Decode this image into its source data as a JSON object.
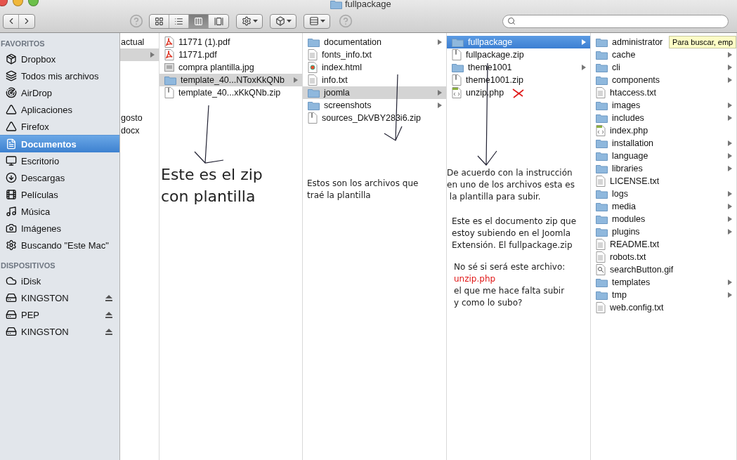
{
  "window": {
    "title": "fullpackage"
  },
  "toolbar": {
    "view_modes": [
      {
        "kind": "icons",
        "selected": false
      },
      {
        "kind": "list",
        "selected": false
      },
      {
        "kind": "columns",
        "selected": true
      },
      {
        "kind": "coverflow",
        "selected": false
      }
    ]
  },
  "sidebar": {
    "sections": [
      {
        "title": "FAVORITOS",
        "items": [
          {
            "label": "Dropbox",
            "kind": "box",
            "selected": false
          },
          {
            "label": "Todos mis archivos",
            "kind": "stack",
            "selected": false
          },
          {
            "label": "AirDrop",
            "kind": "airdrop",
            "selected": false
          },
          {
            "label": "Aplicaciones",
            "kind": "apps",
            "selected": false
          },
          {
            "label": "Firefox",
            "kind": "apps",
            "selected": false
          },
          {
            "label": "Documentos",
            "kind": "documents",
            "selected": true
          },
          {
            "label": "Escritorio",
            "kind": "desktop",
            "selected": false
          },
          {
            "label": "Descargas",
            "kind": "downloads",
            "selected": false
          },
          {
            "label": "Películas",
            "kind": "movies",
            "selected": false
          },
          {
            "label": "Música",
            "kind": "music",
            "selected": false
          },
          {
            "label": "Imágenes",
            "kind": "camera",
            "selected": false
          },
          {
            "label": "Buscando \"Este Mac\"",
            "kind": "gear",
            "selected": false
          }
        ]
      },
      {
        "title": "DISPOSITIVOS",
        "items": [
          {
            "label": "iDisk",
            "kind": "idisk",
            "selected": false,
            "eject": false
          },
          {
            "label": "KINGSTON",
            "kind": "drive",
            "selected": false,
            "eject": true
          },
          {
            "label": "PEP",
            "kind": "drive",
            "selected": false,
            "eject": true
          },
          {
            "label": "KINGSTON",
            "kind": "drive",
            "selected": false,
            "eject": true
          }
        ]
      }
    ]
  },
  "columns": [
    {
      "active": false,
      "items": [
        {
          "name": "actual",
          "kind": "partial",
          "selected": false
        },
        {
          "kind": "folder",
          "selected": true
        },
        {
          "kind": "blank",
          "selected": false
        },
        {
          "kind": "blank",
          "selected": false
        },
        {
          "kind": "blank",
          "selected": false
        },
        {
          "kind": "blank",
          "selected": false
        },
        {
          "name": "gosto",
          "kind": "partial",
          "selected": false
        },
        {
          "name": "docx",
          "kind": "partial",
          "selected": false
        }
      ]
    },
    {
      "active": false,
      "items": [
        {
          "name": "11771 (1).pdf",
          "kind": "pdf",
          "selected": false
        },
        {
          "name": "11771.pdf",
          "kind": "pdf",
          "selected": false
        },
        {
          "name": "compra plantilla.jpg",
          "kind": "image",
          "selected": false
        },
        {
          "name": "template_40...NToxKkQNb",
          "kind": "folder",
          "selected": true
        },
        {
          "name": "template_40...xKkQNb.zip",
          "kind": "zip",
          "selected": false
        }
      ]
    },
    {
      "active": false,
      "items": [
        {
          "name": "documentation",
          "kind": "folder",
          "selected": false
        },
        {
          "name": "fonts_info.txt",
          "kind": "text",
          "selected": false
        },
        {
          "name": "index.html",
          "kind": "html",
          "selected": false
        },
        {
          "name": "info.txt",
          "kind": "text",
          "selected": false
        },
        {
          "name": "joomla",
          "kind": "folder",
          "selected": true
        },
        {
          "name": "screenshots",
          "kind": "folder",
          "selected": false
        },
        {
          "name": "sources_DkVBY283i6.zip",
          "kind": "zip",
          "selected": false
        }
      ]
    },
    {
      "active": true,
      "items": [
        {
          "name": "fullpackage",
          "kind": "folder",
          "selected": true
        },
        {
          "name": "fullpackage.zip",
          "kind": "zip",
          "selected": false
        },
        {
          "name": "theme1001",
          "kind": "folder",
          "selected": false
        },
        {
          "name": "theme1001.zip",
          "kind": "zip",
          "selected": false
        },
        {
          "name": "unzip.php",
          "kind": "php",
          "selected": false
        }
      ]
    },
    {
      "items": [
        {
          "name": "administrator",
          "kind": "folder",
          "selected": false
        },
        {
          "name": "cache",
          "kind": "folder",
          "selected": false
        },
        {
          "name": "cli",
          "kind": "folder",
          "selected": false
        },
        {
          "name": "components",
          "kind": "folder",
          "selected": false
        },
        {
          "name": "htaccess.txt",
          "kind": "text",
          "selected": false
        },
        {
          "name": "images",
          "kind": "folder",
          "selected": false
        },
        {
          "name": "includes",
          "kind": "folder",
          "selected": false
        },
        {
          "name": "index.php",
          "kind": "php",
          "selected": false
        },
        {
          "name": "installation",
          "kind": "folder",
          "selected": false
        },
        {
          "name": "language",
          "kind": "folder",
          "selected": false
        },
        {
          "name": "libraries",
          "kind": "folder",
          "selected": false
        },
        {
          "name": "LICENSE.txt",
          "kind": "text",
          "selected": false
        },
        {
          "name": "logs",
          "kind": "folder",
          "selected": false
        },
        {
          "name": "media",
          "kind": "folder",
          "selected": false
        },
        {
          "name": "modules",
          "kind": "folder",
          "selected": false
        },
        {
          "name": "plugins",
          "kind": "folder",
          "selected": false
        },
        {
          "name": "README.txt",
          "kind": "text",
          "selected": false
        },
        {
          "name": "robots.txt",
          "kind": "text",
          "selected": false
        },
        {
          "name": "searchButton.gif",
          "kind": "gif",
          "selected": false
        },
        {
          "name": "templates",
          "kind": "folder",
          "selected": false
        },
        {
          "name": "tmp",
          "kind": "folder",
          "selected": false
        },
        {
          "name": "web.config.txt",
          "kind": "text",
          "selected": false
        }
      ]
    }
  ],
  "annotations": [
    {
      "kind": "large",
      "lines": [
        {
          "text": "Este es el zip",
          "highlighted": false
        },
        {
          "text": "con plantilla",
          "highlighted": false
        }
      ]
    },
    {
      "kind": "small",
      "lines": [
        {
          "text": "Estos son los archivos que",
          "highlighted": false
        },
        {
          "text": "traé la plantilla",
          "highlighted": false
        }
      ]
    },
    {
      "kind": "small",
      "lines": [
        {
          "text": "De acuerdo con la instrucción",
          "highlighted": false
        },
        {
          "text": "en uno de los archivos esta es",
          "highlighted": false
        },
        {
          "text": " la plantilla para subir.",
          "highlighted": false
        }
      ]
    },
    {
      "kind": "small",
      "lines": [
        {
          "text": "Este es el documento zip que",
          "highlighted": false
        },
        {
          "text": "estoy subiendo en el Joomla",
          "highlighted": false
        },
        {
          "text": "Extensión. El fullpackage.zip",
          "highlighted": false
        }
      ]
    },
    {
      "kind": "small",
      "lines": [
        {
          "text": "No sé si será este archivo:",
          "highlighted": false
        },
        {
          "text": "unzip.php",
          "highlighted": true
        },
        {
          "text": "el que me hace falta subir",
          "highlighted": false
        },
        {
          "text": "y como lo subo?",
          "highlighted": false
        }
      ]
    }
  ],
  "tooltip": {
    "text": "Para buscar, emp"
  }
}
